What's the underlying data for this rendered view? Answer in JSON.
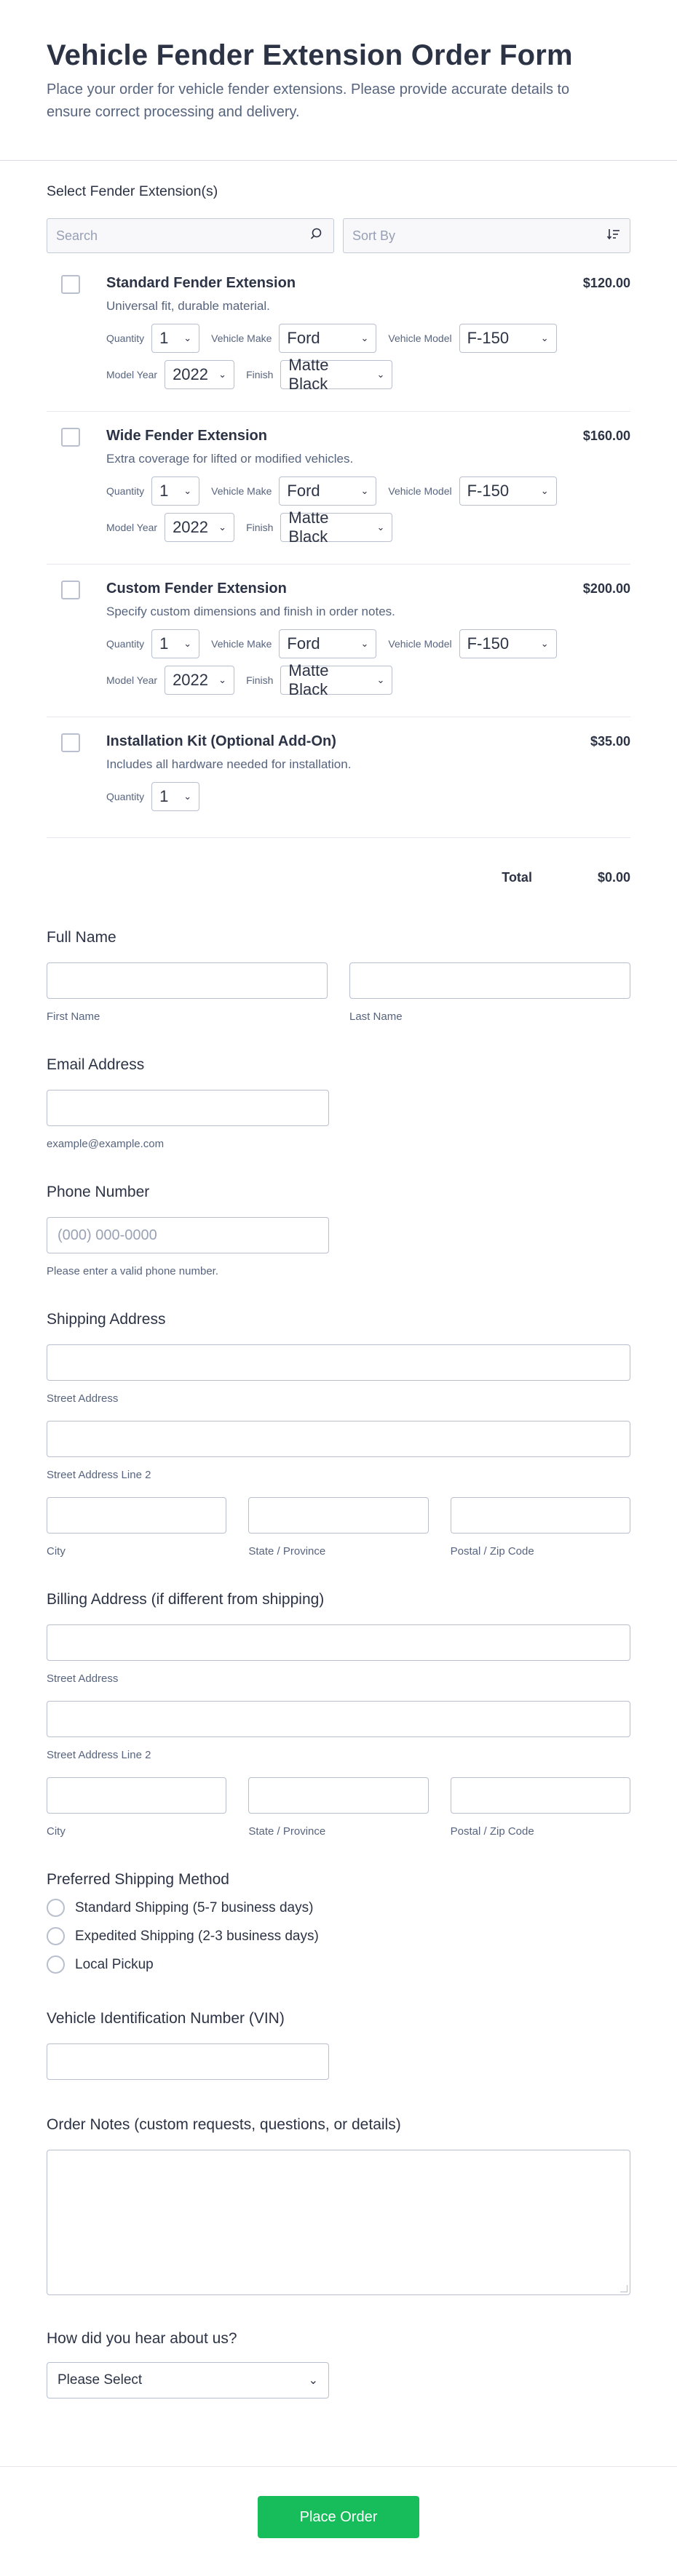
{
  "header": {
    "title": "Vehicle Fender Extension Order Form",
    "description": "Place your order for vehicle fender extensions. Please provide accurate details to ensure correct processing and delivery."
  },
  "products_section": {
    "label": "Select Fender Extension(s)",
    "search_placeholder": "Search",
    "sort_label": "Sort By",
    "items": [
      {
        "name": "Standard Fender Extension",
        "price": "$120.00",
        "description": "Universal fit, durable material.",
        "options": {
          "quantity_label": "Quantity",
          "quantity": "1",
          "make_label": "Vehicle Make",
          "make": "Ford",
          "model_label": "Vehicle Model",
          "model": "F-150",
          "year_label": "Model Year",
          "year": "2022",
          "finish_label": "Finish",
          "finish": "Matte Black"
        }
      },
      {
        "name": "Wide Fender Extension",
        "price": "$160.00",
        "description": "Extra coverage for lifted or modified vehicles.",
        "options": {
          "quantity_label": "Quantity",
          "quantity": "1",
          "make_label": "Vehicle Make",
          "make": "Ford",
          "model_label": "Vehicle Model",
          "model": "F-150",
          "year_label": "Model Year",
          "year": "2022",
          "finish_label": "Finish",
          "finish": "Matte Black"
        }
      },
      {
        "name": "Custom Fender Extension",
        "price": "$200.00",
        "description": "Specify custom dimensions and finish in order notes.",
        "options": {
          "quantity_label": "Quantity",
          "quantity": "1",
          "make_label": "Vehicle Make",
          "make": "Ford",
          "model_label": "Vehicle Model",
          "model": "F-150",
          "year_label": "Model Year",
          "year": "2022",
          "finish_label": "Finish",
          "finish": "Matte Black"
        }
      },
      {
        "name": "Installation Kit (Optional Add-On)",
        "price": "$35.00",
        "description": "Includes all hardware needed for installation.",
        "options": {
          "quantity_label": "Quantity",
          "quantity": "1"
        }
      }
    ],
    "total_label": "Total",
    "total_value": "$0.00"
  },
  "full_name": {
    "label": "Full Name",
    "first_sub": "First Name",
    "last_sub": "Last Name"
  },
  "email": {
    "label": "Email Address",
    "sub": "example@example.com"
  },
  "phone": {
    "label": "Phone Number",
    "placeholder": "(000) 000-0000",
    "sub": "Please enter a valid phone number."
  },
  "shipping": {
    "label": "Shipping Address",
    "street": "Street Address",
    "street2": "Street Address Line 2",
    "city": "City",
    "state": "State / Province",
    "zip": "Postal / Zip Code"
  },
  "billing": {
    "label": "Billing Address (if different from shipping)",
    "street": "Street Address",
    "street2": "Street Address Line 2",
    "city": "City",
    "state": "State / Province",
    "zip": "Postal / Zip Code"
  },
  "shipping_method": {
    "label": "Preferred Shipping Method",
    "options": [
      "Standard Shipping (5-7 business days)",
      "Expedited Shipping (2-3 business days)",
      "Local Pickup"
    ]
  },
  "vin": {
    "label": "Vehicle Identification Number (VIN)"
  },
  "notes": {
    "label": "Order Notes (custom requests, questions, or details)"
  },
  "referral": {
    "label": "How did you hear about us?",
    "selected": "Please Select"
  },
  "submit": {
    "label": "Place Order"
  },
  "colors": {
    "accent": "#18bd5b",
    "text": "#2c3345",
    "muted": "#57647e",
    "border": "#b9bfce"
  }
}
